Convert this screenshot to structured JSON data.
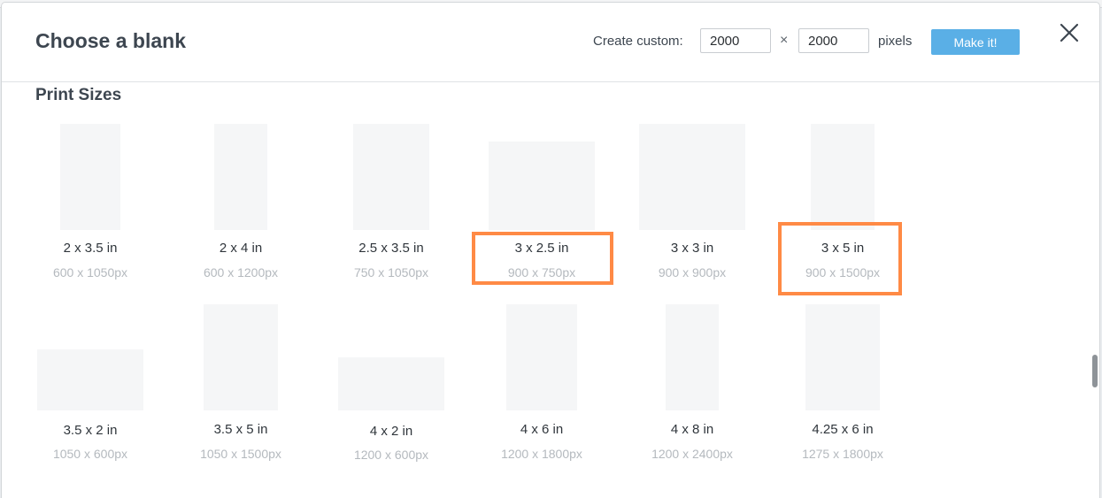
{
  "modal": {
    "title": "Choose a blank",
    "custom_label": "Create custom:",
    "width_value": "2000",
    "height_value": "2000",
    "times_sign": "×",
    "unit_label": "pixels",
    "make_button_label": "Make it!",
    "close_icon": "close-icon"
  },
  "section": {
    "title": "Print Sizes"
  },
  "accent_color": "#ff8a45",
  "button_color": "#5aafe6",
  "tiles": [
    {
      "label": "2 x 3.5 in",
      "size": "600 x 1050px",
      "highlighted": false
    },
    {
      "label": "2 x 4 in",
      "size": "600 x 1200px",
      "highlighted": false
    },
    {
      "label": "2.5 x 3.5 in",
      "size": "750 x 1050px",
      "highlighted": false
    },
    {
      "label": "3 x 2.5 in",
      "size": "900 x 750px",
      "highlighted": true
    },
    {
      "label": "3 x 3 in",
      "size": "900 x 900px",
      "highlighted": false
    },
    {
      "label": "3 x 5 in",
      "size": "900 x 1500px",
      "highlighted": true
    },
    {
      "label": "3.5 x 2 in",
      "size": "1050 x 600px",
      "highlighted": false
    },
    {
      "label": "3.5 x 5 in",
      "size": "1050 x 1500px",
      "highlighted": false
    },
    {
      "label": "4 x 2 in",
      "size": "1200 x 600px",
      "highlighted": false
    },
    {
      "label": "4 x 6 in",
      "size": "1200 x 1800px",
      "highlighted": false
    },
    {
      "label": "4 x 8 in",
      "size": "1200 x 2400px",
      "highlighted": false
    },
    {
      "label": "4.25 x 6 in",
      "size": "1275 x 1800px",
      "highlighted": false
    }
  ]
}
